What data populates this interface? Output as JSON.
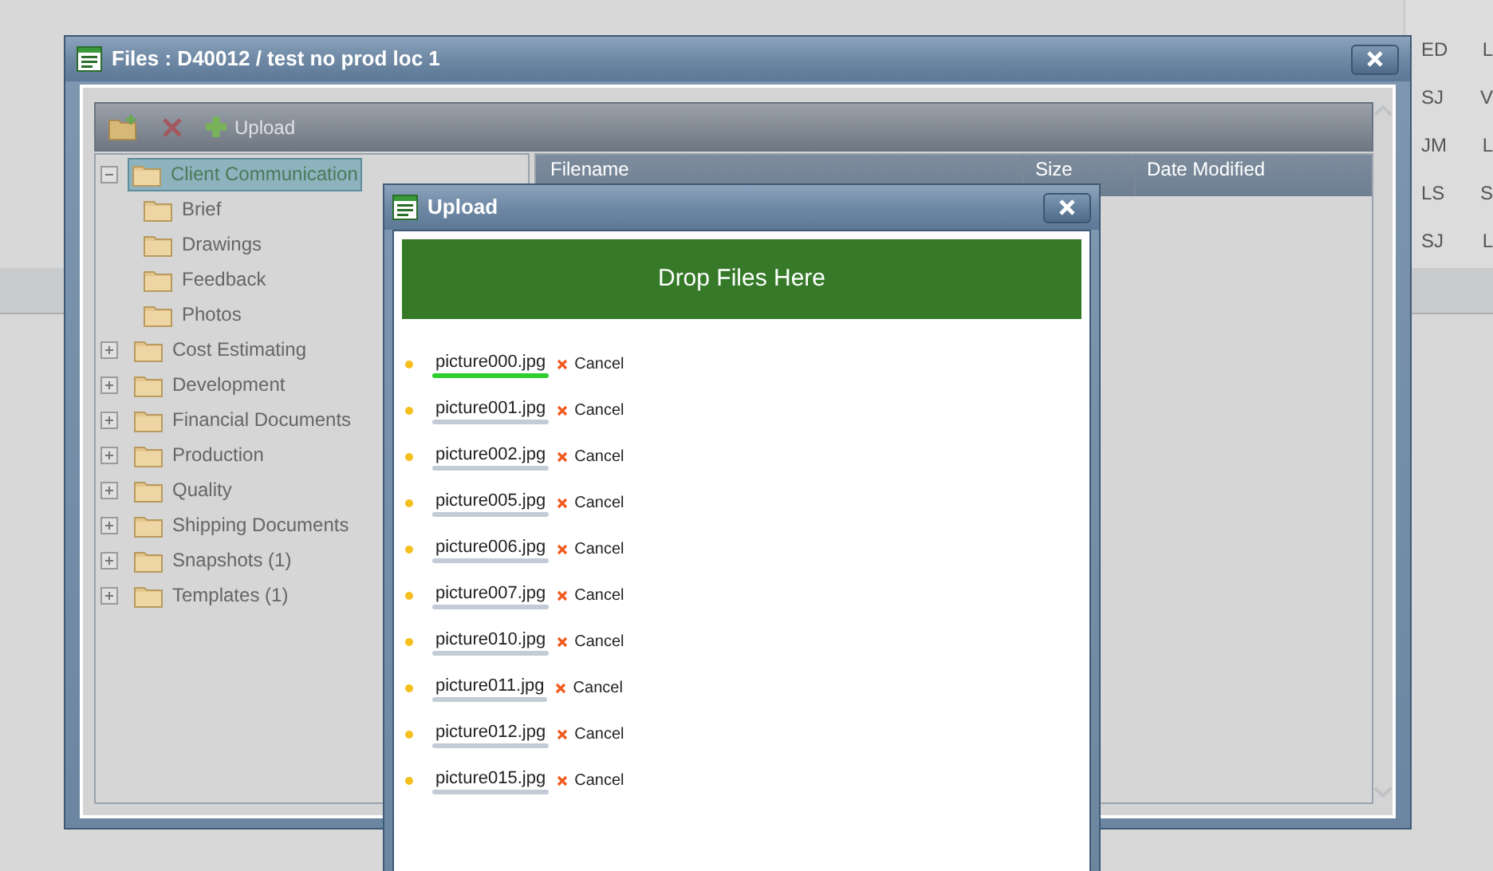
{
  "background_table": {
    "rows": [
      {
        "column_1": "ED",
        "column_2": "L"
      },
      {
        "column_1": "SJ",
        "column_2": "V"
      },
      {
        "column_1": "JM",
        "column_2": "L"
      },
      {
        "column_1": "LS",
        "column_2": "S"
      },
      {
        "column_1": "SJ",
        "column_2": "L"
      }
    ]
  },
  "files_window": {
    "title": "Files : D40012 / test no prod loc 1",
    "toolbar": {
      "upload_label": "Upload"
    },
    "tree": [
      {
        "label": "Client Communication",
        "expanded": true,
        "selected": true,
        "children": [
          {
            "label": "Brief",
            "selected": false
          },
          {
            "label": "Drawings",
            "selected": false
          },
          {
            "label": "Feedback",
            "selected": false
          },
          {
            "label": "Photos",
            "selected": false
          }
        ]
      },
      {
        "label": "Cost Estimating",
        "expanded": false,
        "selected": false
      },
      {
        "label": "Development",
        "expanded": false,
        "selected": false
      },
      {
        "label": "Financial Documents",
        "expanded": false,
        "selected": false
      },
      {
        "label": "Production",
        "expanded": false,
        "selected": false
      },
      {
        "label": "Quality",
        "expanded": false,
        "selected": false
      },
      {
        "label": "Shipping Documents",
        "expanded": false,
        "selected": false
      },
      {
        "label": "Snapshots (1)",
        "expanded": false,
        "selected": false
      },
      {
        "label": "Templates (1)",
        "expanded": false,
        "selected": false
      }
    ],
    "table": {
      "columns": [
        "Filename",
        "Size",
        "Date Modified"
      ]
    }
  },
  "upload_dialog": {
    "title": "Upload",
    "drop_zone": "Drop Files Here",
    "files": [
      {
        "name": "picture000.jpg",
        "kind": "uploading",
        "cancel": "Cancel"
      },
      {
        "name": "picture001.jpg",
        "kind": "queued",
        "cancel": "Cancel"
      },
      {
        "name": "picture002.jpg",
        "kind": "queued",
        "cancel": "Cancel"
      },
      {
        "name": "picture005.jpg",
        "kind": "queued",
        "cancel": "Cancel"
      },
      {
        "name": "picture006.jpg",
        "kind": "queued",
        "cancel": "Cancel"
      },
      {
        "name": "picture007.jpg",
        "kind": "queued",
        "cancel": "Cancel"
      },
      {
        "name": "picture010.jpg",
        "kind": "queued",
        "cancel": "Cancel"
      },
      {
        "name": "picture011.jpg",
        "kind": "queued",
        "cancel": "Cancel"
      },
      {
        "name": "picture012.jpg",
        "kind": "queued",
        "cancel": "Cancel"
      },
      {
        "name": "picture015.jpg",
        "kind": "queued",
        "cancel": "Cancel"
      }
    ]
  }
}
